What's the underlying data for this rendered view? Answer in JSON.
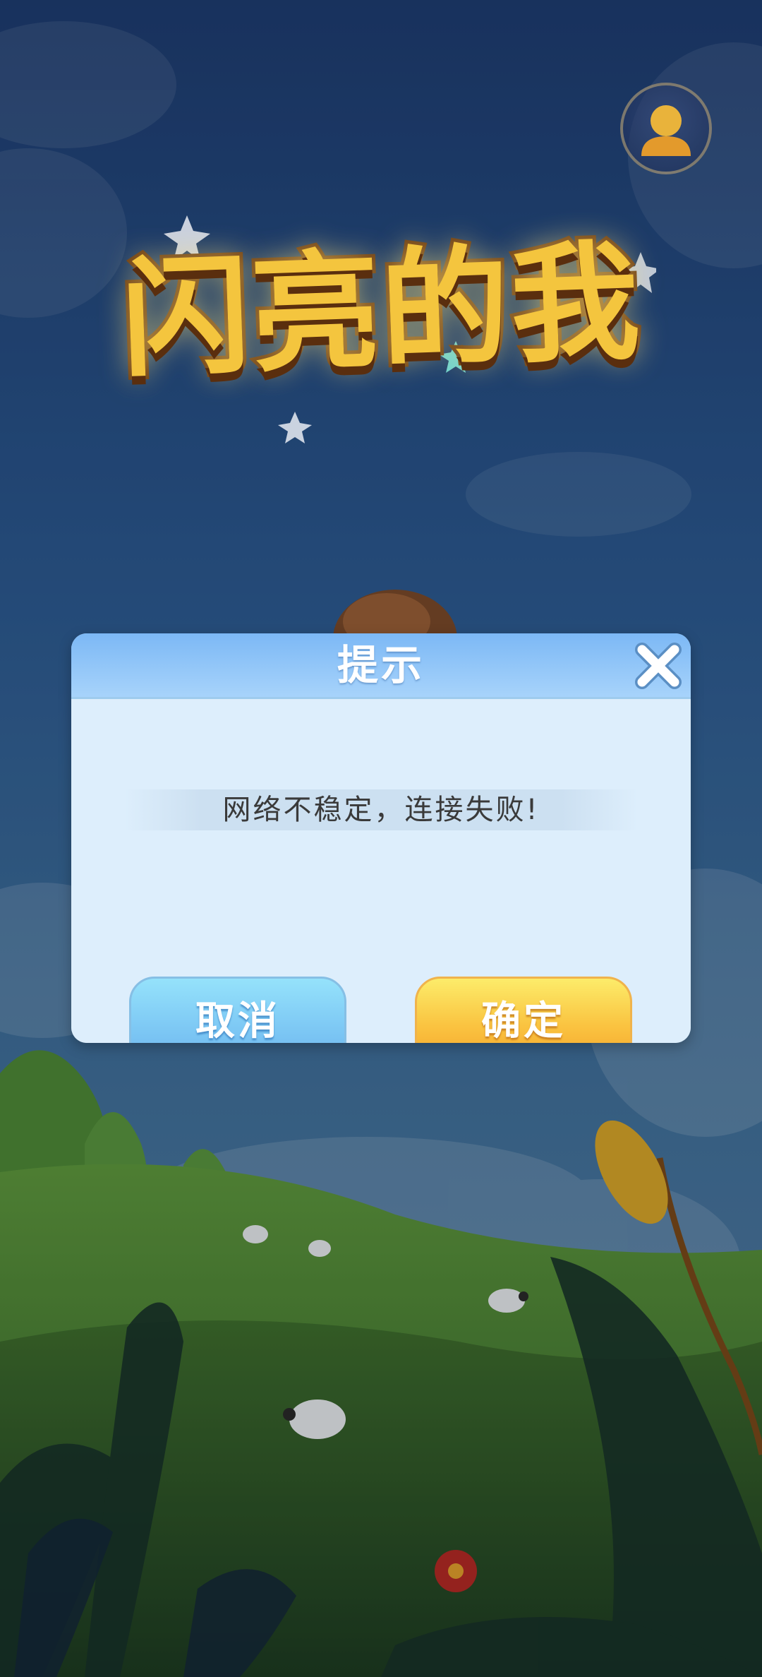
{
  "game": {
    "logo_text": "闪亮的我"
  },
  "dialog": {
    "title": "提示",
    "message": "网络不稳定，连接失败!",
    "cancel_label": "取消",
    "confirm_label": "确定"
  },
  "icons": {
    "avatar": "user-avatar-icon",
    "close": "close-x-icon"
  },
  "colors": {
    "dialog_header": "#7cb8f5",
    "dialog_body": "#ddeefc",
    "cancel_button": "#7fcaf5",
    "confirm_button": "#fac441",
    "logo_fill": "#f4c53e"
  }
}
